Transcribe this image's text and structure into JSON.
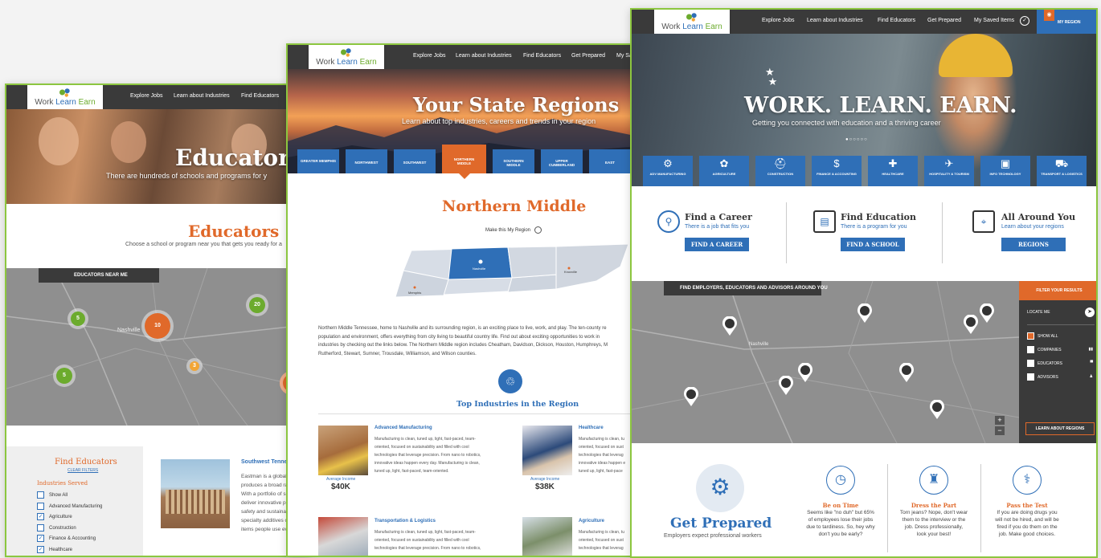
{
  "brand": {
    "part1": "Work ",
    "part2": "Learn ",
    "part3": "Earn"
  },
  "p1": {
    "nav": [
      "Explore Jobs",
      "Learn about Industries",
      "Find Educators"
    ],
    "hero_title": "Educators",
    "hero_sub": "There are hundreds of schools and programs for y",
    "section_title": "Educators",
    "section_sub": "Choose a school or program near you that gets you ready for a",
    "map_tag": "EDUCATORS NEAR ME",
    "clusters": [
      "5",
      "10",
      "20",
      "3",
      "5"
    ],
    "map_city": "Nashville",
    "filter_title": "Find Educators",
    "clear_filters": "CLEAR FILTERS",
    "industries_label": "Industries Served",
    "filters": [
      {
        "label": "Show All",
        "checked": false
      },
      {
        "label": "Advanced Manufacturing",
        "checked": false
      },
      {
        "label": "Agriculture",
        "checked": true
      },
      {
        "label": "Construction",
        "checked": false
      },
      {
        "label": "Finance & Accounting",
        "checked": true
      },
      {
        "label": "Healthcare",
        "checked": true
      }
    ],
    "school_name": "Southwest Tennes",
    "school_text": [
      "Eastman is a global a",
      "produces a broad ra",
      "With a portfolio of s",
      "deliver innovative pr",
      "safety and sustainab",
      "specialty additives c",
      "items people use eve"
    ]
  },
  "p2": {
    "nav": [
      "Explore Jobs",
      "Learn about Industries",
      "Find Educators",
      "Get Prepared",
      "My Sa"
    ],
    "hero_title": "Your State Regions",
    "hero_sub": "Learn about top industries, careers and trends in your region",
    "tabs": [
      "GREATER MEMPHIS",
      "NORTHWEST",
      "SOUTHWEST",
      "NORTHERN MIDDLE",
      "SOUTHERN MIDDLE",
      "UPPER CUMBERLAND",
      "EAST"
    ],
    "region_title": "Northern Middle",
    "make_region": "Make this My Region",
    "map_labels": [
      "Nashville",
      "Knoxville",
      "Memphis"
    ],
    "description": [
      "Northern Middle Tennessee, home to Nashville and its surrounding region, is an exciting place to live, work, and play. The ten-county re",
      "population and environment, offers everything from city living to beautiful country life. Find out about exciting opportunities to work in",
      "industries by checking out the links below. The Northern Middle region includes Cheatham, Davidson, Dickson, Houston, Humphreys, M",
      "Rutherford, Stewart, Sumner, Trousdale, Williamson, and Wilson counties."
    ],
    "top_industries": "Top Industries in the Region",
    "industries": [
      {
        "name": "Advanced Manufacturing",
        "text": [
          "Manufacturing is clean, tuned up, light, fast-paced, team-",
          "oriented, focused on sustainability and filled with cool",
          "technologies that leverage precision. From nano to robotics,",
          "innovative ideas happen every day. Manufacturing is clean,",
          "tuned up, light, fast-paced, team-oriented."
        ],
        "income_label": "Average Income",
        "income": "$40K"
      },
      {
        "name": "Healthcare",
        "text": [
          "Manufacturing is clean, tu",
          "oriented, focused on sust",
          "technologies that leverag",
          "innovative ideas happen e",
          "tuned up, light, fast-pace"
        ],
        "income_label": "Average Income",
        "income": "$38K"
      },
      {
        "name": "Transportation & Logistics",
        "text": [
          "Manufacturing is clean, tuned up, light, fast-paced, team-",
          "oriented, focused on sustainability and filled with cool",
          "technologies that leverage precision. From nano to robotics,"
        ]
      },
      {
        "name": "Agriculture",
        "text": [
          "Manufacturing is clean, tu",
          "oriented, focused on sust",
          "technologies that leverag"
        ]
      }
    ]
  },
  "p3": {
    "nav": [
      "Explore Jobs",
      "Learn about Industries",
      "Find Educators",
      "Get Prepared",
      "My Saved Items"
    ],
    "my_region": "MY REGION",
    "hero_title": "WORK. LEARN. EARN.",
    "hero_sub": "Getting you connected with education and a thriving career",
    "industry_tiles": [
      "ADV MANUFACTURING",
      "AGRICULTURE",
      "CONSTRUCTION",
      "FINANCE & ACCOUNTING",
      "HEALTHCARE",
      "HOSPITALITY & TOURISM",
      "INFO TECHNOLOGY",
      "TRANSPORT & LOGISTICS"
    ],
    "features": [
      {
        "title": "Find a Career",
        "sub": "There is a job that fits you",
        "button": "FIND A CAREER"
      },
      {
        "title": "Find Education",
        "sub": "There is a program for you",
        "button": "FIND A SCHOOL"
      },
      {
        "title": "All Around You",
        "sub": "Learn about your regions",
        "button": "REGIONS"
      }
    ],
    "map_tag": "FIND EMPLOYERS, EDUCATORS AND ADVISORS AROUND YOU",
    "map_city": "Nashville",
    "filter_header": "FILTER YOUR RESULTS",
    "locate_me": "LOCATE ME",
    "filters": [
      "SHOW ALL",
      "COMPANIES",
      "EDUCATORS",
      "ADVISORS"
    ],
    "learn_regions": "LEARN ABOUT REGIONS",
    "zoom_in": "+",
    "zoom_out": "−",
    "get_prepared_title": "Get Prepared",
    "get_prepared_sub": "Employers expect professional workers",
    "tips": [
      {
        "title": "Be on Time",
        "text": [
          "Seems like \"no duh\" but 65%",
          "of employees lose their jobs",
          "due to tardiness. So, hey why",
          "don't you be early?"
        ]
      },
      {
        "title": "Dress the Part",
        "text": [
          "Torn jeans? Nope, don't wear",
          "them to the interview or the",
          "job. Dress professionally,",
          "look your best!"
        ]
      },
      {
        "title": "Pass the Test",
        "text": [
          "If you are doing drugs you",
          "will not be hired, and will be",
          "fired if you do them on the",
          "job. Make good choices."
        ]
      }
    ]
  }
}
